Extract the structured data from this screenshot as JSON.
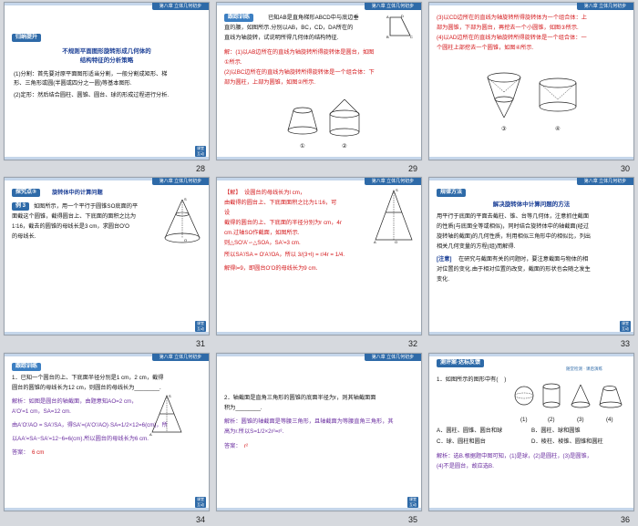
{
  "slides": [
    {
      "number": "28",
      "header": "第八章  立体几何初步",
      "tag": "归纳提升",
      "title_line1": "不规则平面图形旋转形成几何体的",
      "title_line2": "结构特征的分析策略",
      "lines": [
        "(1)分割：首先要对原平面图形适当分割，一般分割成矩形、梯",
        "形、三角形或圆(半圆或四分之一圆)等基本图形.",
        "(2)定形：然后结合圆柱、圆锥、圆台、球的形成过程进行分析."
      ],
      "nav": "课堂 互动"
    },
    {
      "number": "29",
      "header": "第八章  立体几何初步",
      "tag": "跟踪训练",
      "lines": [
        "已知AB是直角梯形ABCD中与底边垂",
        "直的腰，如图所示.分别以AB，BC，CD，DA所在的",
        "直线为轴旋转，试说明所得几何体的结构特征."
      ],
      "answer_lines": [
        "解：(1)以AB边所在的直线为轴旋转所得旋转体是圆台，如图",
        "①所示.",
        "(2)以BC边所在的直线为轴旋转所得旋转体是一个组合体：下",
        "部为圆柱，上部为圆锥，如图②所示."
      ],
      "fig_labels": [
        "①",
        "②"
      ]
    },
    {
      "number": "30",
      "header": "第八章  立体几何初步",
      "answer_lines": [
        "(3)以CD边所在的直线为轴旋转所得旋转体为一个组合体：上",
        "部为圆锥，下部为圆台，再挖去一个小圆锥，如图③所示.",
        "(4)以AD边所在的直线为轴旋转所得旋转体是一个组合体：一",
        "个圆柱上部挖去一个圆锥，如图④所示."
      ],
      "fig_labels": [
        "③",
        "④"
      ]
    },
    {
      "number": "31",
      "header": "第八章  立体几何初步",
      "tag": "探究点③",
      "subtitle": "旋转体中的计算问题",
      "example_tag": "例 3",
      "lines": [
        "如图所示，用一个平行于圆锥SO底面的平",
        "面截这个圆锥，截得圆台上、下底面的面积之比为",
        "1∶16，截去的圆锥的母线长是3 cm，求圆台O′O",
        "的母线长."
      ],
      "nav": "课堂 互动"
    },
    {
      "number": "32",
      "header": "第八章  立体几何初步",
      "answer_lines": [
        "【解】  设圆台的母线长为l cm，",
        "由截得的圆台上、下底面面积之比为1∶16，可",
        "设",
        "截得的圆台的上、下底面的半径分别为r cm，4r",
        "cm.过轴SO作截面，如图所示.",
        "则△SO′A′∽△SOA，SA′=3 cm.",
        "所以SA′/SA = O′A′/OA，所以 3/(3+l) = r/4r = 1/4.",
        "解得l=9，即圆台O′O的母线长为9 cm."
      ]
    },
    {
      "number": "33",
      "header": "第八章  立体几何初步",
      "tag": "规律方法",
      "subtitle": "解决旋转体中计算问题的方法",
      "lines": [
        "用平行于底面的平面去截柱、锥、台等几何体，注意抓住截面",
        "的性质(与底面全等或相似)，同时结合旋转体中的轴截面(经过",
        "旋转轴的截面)的几何性质，利用相似三角形中的相似比，列出",
        "相关几何变量的方程(组)而解得."
      ],
      "note_label": "[注意]",
      "note_lines": [
        "在研究与截面有关的问题时，要注意截面与物体的相",
        "对位置的变化.由于相对位置的改变，截面的形状也会随之发生",
        "变化."
      ],
      "nav": "课堂 互动"
    },
    {
      "number": "34",
      "header": "第八章  立体几何初步",
      "tag": "跟踪训练",
      "lines": [
        "1．已知一个圆台的上、下底面半径分别是1 cm，2 cm，截得",
        "圆台的圆锥的母线长为12 cm，则圆台的母线长为________."
      ],
      "answer_lines": [
        "解析：如图是圆台的轴截面，由题意知AO=2 cm，",
        "A′O′=1 cm，SA=12 cm.",
        "由A′O′/AO = SA′/SA，得SA′=(A′O′/AO)·SA=1/2×12=6(cm)，所",
        "以AA′=SA−SA′=12−6=6(cm).所以圆台的母线长为6 cm."
      ],
      "answer_label": "答案：",
      "answer": "6 cm",
      "nav": "课堂 互动"
    },
    {
      "number": "35",
      "header": "第八章  立体几何初步",
      "lines": [
        "2．轴截面是直角三角形的圆锥的底面半径为r，则其轴截面面",
        "积为________."
      ],
      "answer_lines": [
        "解析：圆锥的轴截面是等腰三角形，且轴截面为等腰直角三角形，其",
        "高为r.所以S=1/2×2r²=r²."
      ],
      "answer_label": "答案：",
      "answer": "r²",
      "nav": "课堂 互动"
    },
    {
      "number": "36",
      "header": "第八章  立体几何初步",
      "tag": "测评案·达标反馈",
      "header_right": "随堂检测 · 课后演练",
      "question": "1．如图所示的图形中有(    )",
      "options": [
        "A．圆柱、圆锥、圆台和球",
        "B．圆柱、球和圆锥",
        "C．球、圆柱和圆台",
        "D．棱柱、棱锥、圆锥和圆柱"
      ],
      "answer_lines": [
        "解析：选B.根据题中图可知，(1)是球，(2)是圆柱，(3)是圆锥，",
        "(4)不是圆台，故应选B."
      ],
      "fig_labels": [
        "(1)",
        "(2)",
        "(3)",
        "(4)"
      ]
    }
  ],
  "note_glyph": "",
  "colors": {
    "accent": "#2e6aa8",
    "red": "#d4181b",
    "purple": "#6a2ea0",
    "background": "#d6d9de"
  }
}
